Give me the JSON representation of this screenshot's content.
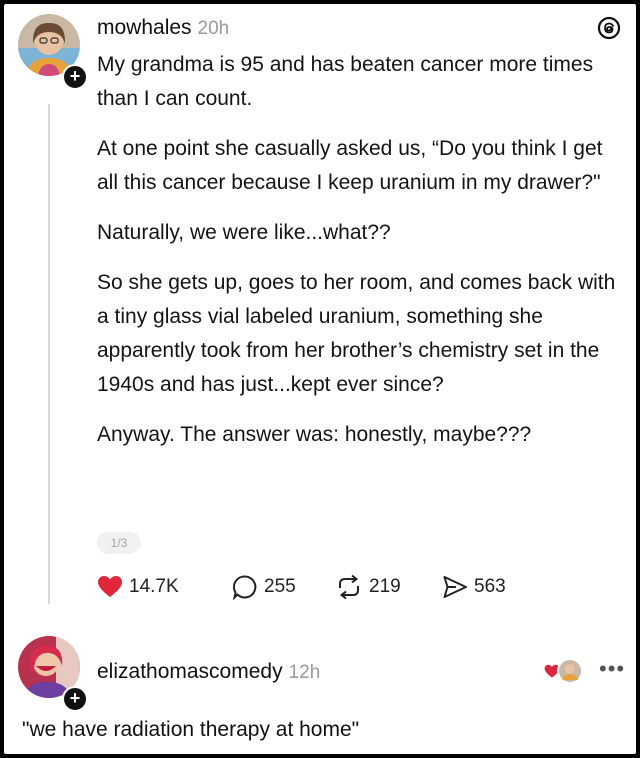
{
  "post": {
    "username": "mowhales",
    "time": "20h",
    "paragraphs": [
      "My grandma is 95 and has beaten cancer more times than I can count.",
      "At one point she casually asked us, “Do you think I get all this cancer because I keep uranium in my drawer?\"",
      "Naturally, we were like...what??",
      "So she gets up, goes to her room, and comes back with a tiny glass vial labeled uranium, something she apparently took from her brother’s chemistry set in the 1940s and has just...kept ever since?",
      "Anyway. The answer was: honestly, maybe???"
    ],
    "page_indicator": "1/3",
    "likes": "14.7K",
    "comments": "255",
    "reposts": "219",
    "shares": "563",
    "follow_symbol": "+"
  },
  "reply": {
    "username": "elizathomascomedy",
    "time": "12h",
    "text": "\"we have radiation therapy at home\"",
    "more_symbol": "•••",
    "follow_symbol": "+"
  },
  "colors": {
    "like": "#e0263a",
    "muted": "#9a9a9a",
    "line": "#d9d9d9"
  },
  "icons": [
    "threads-logo-icon",
    "heart-icon",
    "comment-icon",
    "repost-icon",
    "share-icon",
    "more-icon",
    "avatar"
  ]
}
